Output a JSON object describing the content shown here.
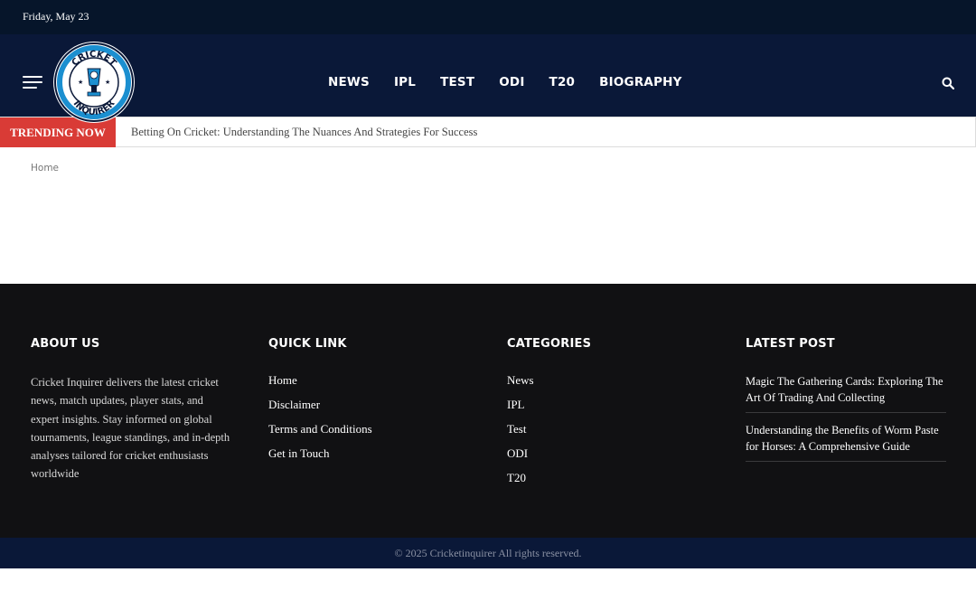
{
  "topbar": {
    "date": "Friday, May 23"
  },
  "header": {
    "logo_text_top": "CRICKET",
    "logo_text_bottom": "INQUIRER",
    "nav": [
      "NEWS",
      "IPL",
      "TEST",
      "ODI",
      "T20",
      "BIOGRAPHY"
    ],
    "icons": {
      "menu": "hamburger-menu-icon",
      "search": "search-icon"
    }
  },
  "trending": {
    "label": "TRENDING NOW",
    "headline": "Betting On Cricket: Understanding The Nuances And Strategies For Success"
  },
  "breadcrumb": {
    "home": "Home"
  },
  "footer": {
    "about": {
      "title": "ABOUT US",
      "text": "Cricket Inquirer delivers the latest cricket news, match updates, player stats, and expert insights. Stay informed on global tournaments, league standings, and in-depth analyses tailored for cricket enthusiasts worldwide"
    },
    "quick_link": {
      "title": "QUICK LINK",
      "items": [
        "Home",
        "Disclaimer",
        "Terms and Conditions",
        "Get in Touch"
      ]
    },
    "categories": {
      "title": "CATEGORIES",
      "items": [
        "News",
        "IPL",
        "Test",
        "ODI",
        "T20"
      ]
    },
    "latest_post": {
      "title": "LATEST POST",
      "items": [
        "Magic The Gathering Cards: Exploring The Art Of Trading And Collecting",
        "Understanding the Benefits of Worm Paste for Horses: A Comprehensive Guide"
      ]
    }
  },
  "copyright": "© 2025 Cricketinquirer All rights reserved.",
  "colors": {
    "topbar": "#06152a",
    "header": "#0a1838",
    "trending_badge": "#d93b36",
    "footer": "#111113",
    "logo_ring": "#1b8fd0"
  }
}
